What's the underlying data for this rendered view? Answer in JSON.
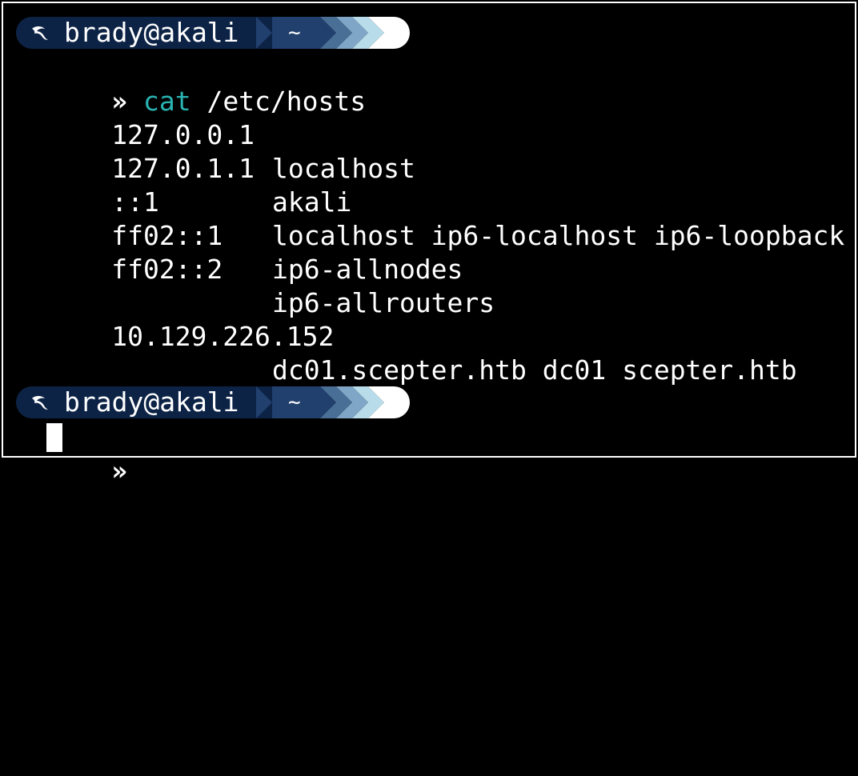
{
  "theme": {
    "background": "#000000",
    "foreground": "#ffffff",
    "command_color": "#2ab3b3",
    "prompt_user_bg": "#0c2346",
    "prompt_dir_bg": "#22406e",
    "prompt_arrow_colors": [
      "#4a6f96",
      "#7fa6c6",
      "#b8dcea",
      "#ffffff"
    ]
  },
  "prompts": [
    {
      "icon": "kali-dragon-icon",
      "user_host": "brady@akali",
      "dir": "~",
      "symbol": "»",
      "command": "cat",
      "args": " /etc/hosts"
    },
    {
      "icon": "kali-dragon-icon",
      "user_host": "brady@akali",
      "dir": "~",
      "symbol": "»",
      "command": "",
      "args": ""
    }
  ],
  "output": {
    "hosts": [
      {
        "ip": "127.0.0.1",
        "names": "localhost"
      },
      {
        "ip": "127.0.1.1",
        "names": "akali"
      },
      {
        "ip": "::1",
        "names": "localhost ip6-localhost ip6-loopback"
      },
      {
        "ip": "ff02::1",
        "names": "ip6-allnodes"
      },
      {
        "ip": "ff02::2",
        "names": "ip6-allrouters"
      },
      {
        "ip": "",
        "names": ""
      },
      {
        "ip": "10.129.226.152",
        "names": "dc01.scepter.htb dc01 scepter.htb"
      }
    ]
  }
}
